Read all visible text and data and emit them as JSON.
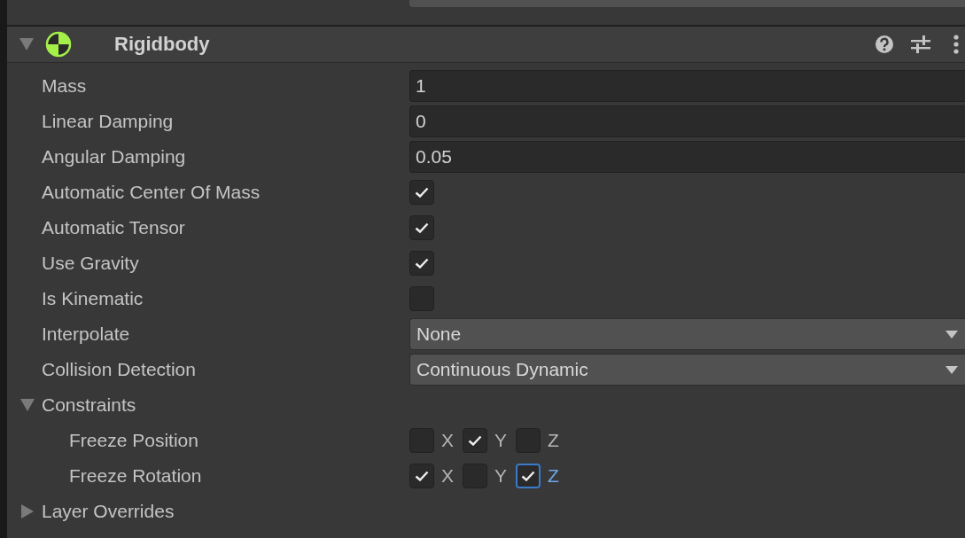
{
  "header": {
    "title": "Rigidbody",
    "expanded": true
  },
  "properties": [
    {
      "kind": "number",
      "label": "Mass",
      "value": "1"
    },
    {
      "kind": "number",
      "label": "Linear Damping",
      "value": "0"
    },
    {
      "kind": "number",
      "label": "Angular Damping",
      "value": "0.05"
    },
    {
      "kind": "checkbox",
      "label": "Automatic Center Of Mass",
      "checked": true
    },
    {
      "kind": "checkbox",
      "label": "Automatic Tensor",
      "checked": true
    },
    {
      "kind": "checkbox",
      "label": "Use Gravity",
      "checked": true
    },
    {
      "kind": "checkbox",
      "label": "Is Kinematic",
      "checked": false
    },
    {
      "kind": "dropdown",
      "label": "Interpolate",
      "value": "None"
    },
    {
      "kind": "dropdown",
      "label": "Collision Detection",
      "value": "Continuous Dynamic"
    },
    {
      "kind": "foldout",
      "label": "Constraints",
      "expanded": true,
      "children": [
        {
          "kind": "axes",
          "label": "Freeze Position",
          "axes": [
            {
              "label": "X",
              "checked": false,
              "focused": false
            },
            {
              "label": "Y",
              "checked": true,
              "focused": false
            },
            {
              "label": "Z",
              "checked": false,
              "focused": false
            }
          ]
        },
        {
          "kind": "axes",
          "label": "Freeze Rotation",
          "axes": [
            {
              "label": "X",
              "checked": true,
              "focused": false
            },
            {
              "label": "Y",
              "checked": false,
              "focused": false
            },
            {
              "label": "Z",
              "checked": true,
              "focused": true
            }
          ]
        }
      ]
    },
    {
      "kind": "foldout",
      "label": "Layer Overrides",
      "expanded": false
    }
  ]
}
